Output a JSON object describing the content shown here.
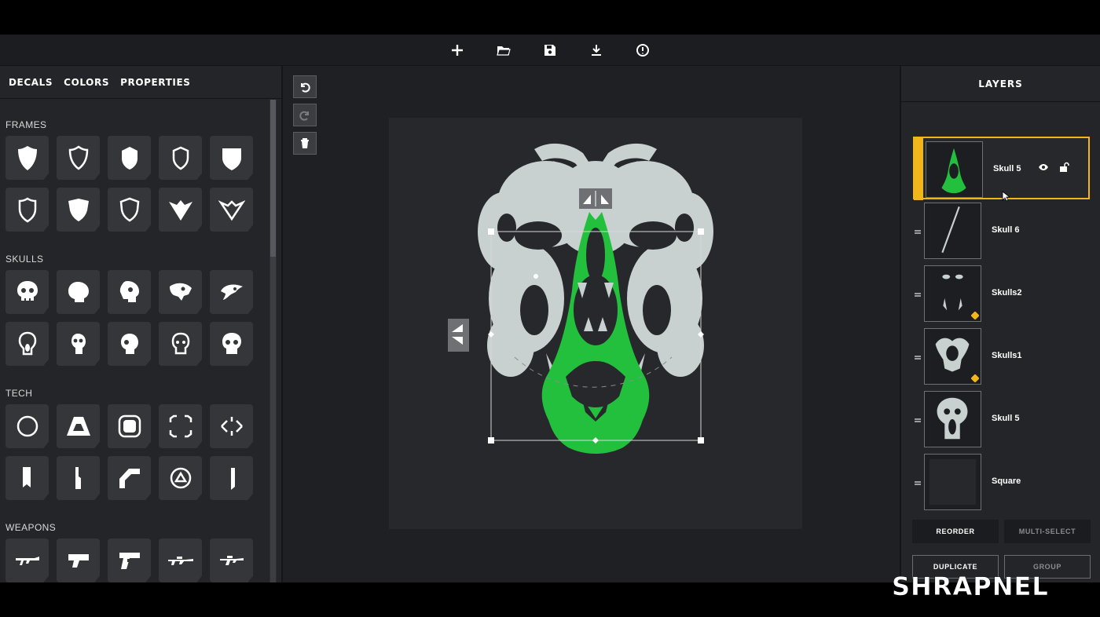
{
  "toolbar": {
    "icons": [
      "plus-icon",
      "folder-open-icon",
      "save-icon",
      "download-icon",
      "info-icon"
    ]
  },
  "left_panel": {
    "tabs": [
      {
        "label": "DECALS"
      },
      {
        "label": "COLORS"
      },
      {
        "label": "PROPERTIES"
      }
    ],
    "sections": [
      {
        "title": "FRAMES"
      },
      {
        "title": "SKULLS"
      },
      {
        "title": "TECH"
      },
      {
        "title": "WEAPONS"
      }
    ]
  },
  "canvas": {
    "tools": [
      "undo-icon",
      "redo-icon",
      "trash-icon"
    ],
    "colors": {
      "background": "#26282b",
      "skull": "#c9d0d0",
      "accent_green": "#22c03c"
    }
  },
  "right_panel": {
    "title": "LAYERS",
    "layers": [
      {
        "name": "Skull 5",
        "active": true
      },
      {
        "name": "Skull 6"
      },
      {
        "name": "Skulls2",
        "badge": true
      },
      {
        "name": "Skulls1",
        "badge": true
      },
      {
        "name": "Skull 5"
      },
      {
        "name": "Square"
      }
    ],
    "buttons": {
      "reorder": "REORDER",
      "multi_select": "MULTI-SELECT",
      "duplicate": "DUPLICATE",
      "group": "GROUP"
    },
    "accent": "#f3b51c"
  },
  "brand": {
    "logo_text": "SHRAPNEL"
  }
}
